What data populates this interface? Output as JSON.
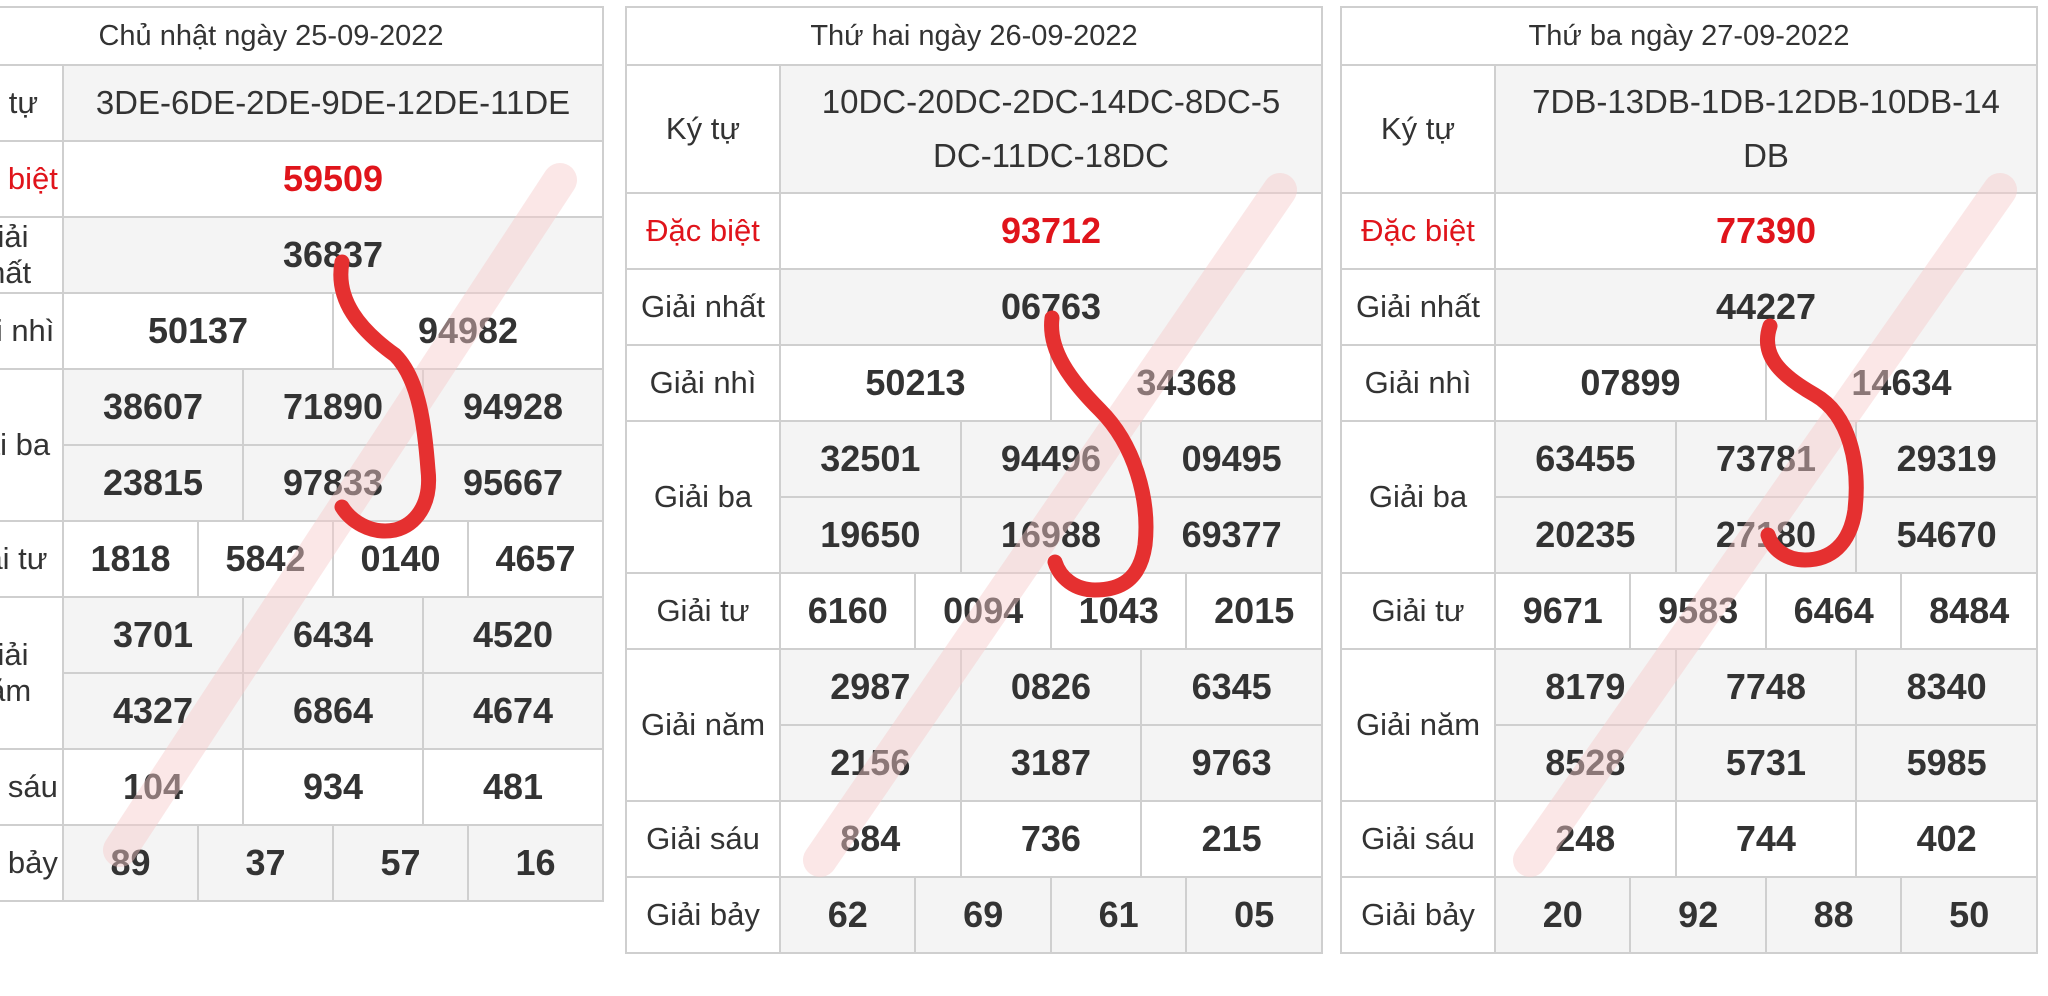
{
  "labels": {
    "ky_tu": "Ký tự",
    "dac_biet": "Đặc biệt",
    "giai_nhat": "Giải nhất",
    "giai_nhi": "Giải nhì",
    "giai_ba": "Giải ba",
    "giai_tu": "Giải tư",
    "giai_nam": "Giải năm",
    "giai_sau": "Giải sáu",
    "giai_bay": "Giải bảy"
  },
  "boards": [
    {
      "title": "Chủ nhật ngày 25-09-2022",
      "ky_tu": "3DE-6DE-2DE-9DE-12DE-11DE",
      "dac_biet": "59509",
      "nhat": "36837",
      "nhi": [
        "50137",
        "94982"
      ],
      "ba": [
        "38607",
        "71890",
        "94928",
        "23815",
        "97833",
        "95667"
      ],
      "tu": [
        "1818",
        "5842",
        "0140",
        "4657"
      ],
      "nam": [
        "3701",
        "6434",
        "4520",
        "4327",
        "6864",
        "4674"
      ],
      "sau": [
        "104",
        "934",
        "481"
      ],
      "bay": [
        "89",
        "37",
        "57",
        "16"
      ]
    },
    {
      "title": "Thứ hai ngày 26-09-2022",
      "ky_tu": "10DC-20DC-2DC-14DC-8DC-5DC-11DC-18DC",
      "dac_biet": "93712",
      "nhat": "06763",
      "nhi": [
        "50213",
        "34368"
      ],
      "ba": [
        "32501",
        "94496",
        "09495",
        "19650",
        "16988",
        "69377"
      ],
      "tu": [
        "6160",
        "0094",
        "1043",
        "2015"
      ],
      "nam": [
        "2987",
        "0826",
        "6345",
        "2156",
        "3187",
        "9763"
      ],
      "sau": [
        "884",
        "736",
        "215"
      ],
      "bay": [
        "62",
        "69",
        "61",
        "05"
      ]
    },
    {
      "title": "Thứ ba ngày 27-09-2022",
      "ky_tu": "7DB-13DB-1DB-12DB-10DB-14DB",
      "dac_biet": "77390",
      "nhat": "44227",
      "nhi": [
        "07899",
        "14634"
      ],
      "ba": [
        "63455",
        "73781",
        "29319",
        "20235",
        "27180",
        "54670"
      ],
      "tu": [
        "9671",
        "9583",
        "6464",
        "8484"
      ],
      "nam": [
        "8179",
        "7748",
        "8340",
        "8528",
        "5731",
        "5985"
      ],
      "sau": [
        "248",
        "744",
        "402"
      ],
      "bay": [
        "20",
        "92",
        "88",
        "50"
      ]
    }
  ],
  "colors": {
    "accent_red": "#e0141b",
    "annotation_stroke": "#e53030",
    "row_shade": "#f4f4f4",
    "border": "#cfcfcf"
  }
}
